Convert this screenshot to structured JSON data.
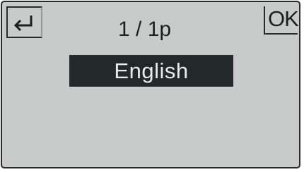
{
  "header": {
    "back_icon": "back-arrow-icon",
    "page_indicator": "1 / 1p",
    "ok_label": "OK"
  },
  "list": {
    "items": [
      {
        "label": "English",
        "selected": true
      }
    ]
  },
  "colors": {
    "screen_background": "#c9cbcb",
    "selection_background": "#23282a",
    "selection_text": "#e9ebeb",
    "text": "#1e1e1e"
  }
}
